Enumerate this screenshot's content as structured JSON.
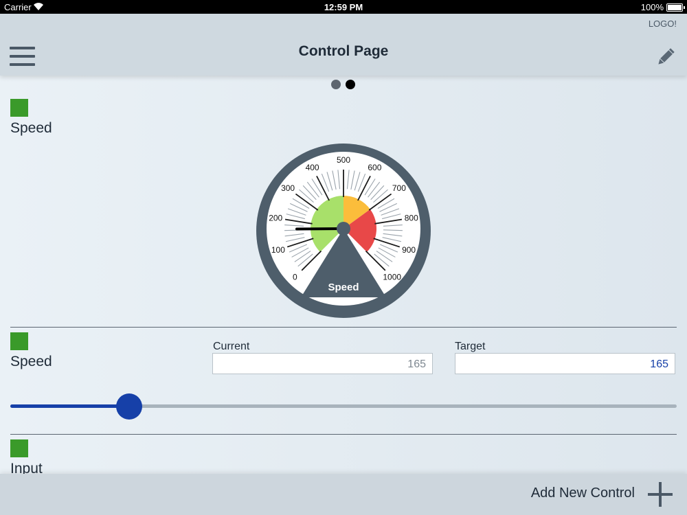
{
  "status_bar": {
    "carrier": "Carrier",
    "time": "12:59 PM",
    "battery": "100%"
  },
  "nav": {
    "title": "Control Page",
    "logo": "LOGO!",
    "menu_icon": "hamburger-menu-icon",
    "edit_icon": "pencil-icon"
  },
  "pager": {
    "pages": 2,
    "active_index": 1
  },
  "controls": [
    {
      "label": "Speed",
      "swatch_color": "#3a9a2a"
    },
    {
      "label": "Speed",
      "swatch_color": "#3a9a2a"
    },
    {
      "label": "Input",
      "swatch_color": "#3a9a2a"
    }
  ],
  "gauge": {
    "label": "Speed",
    "min": 0,
    "max": 1000,
    "tick_labels": [
      "0",
      "100",
      "200",
      "300",
      "400",
      "500",
      "600",
      "700",
      "800",
      "900",
      "1000"
    ],
    "value": 165,
    "zones": [
      {
        "from": 0,
        "to": 500,
        "color": "#a8e06a"
      },
      {
        "from": 500,
        "to": 700,
        "color": "#fbbd3b"
      },
      {
        "from": 700,
        "to": 1000,
        "color": "#e84848"
      }
    ],
    "colors": {
      "body": "#4e5e6b",
      "face": "#ffffff",
      "needle": "#000000"
    }
  },
  "fields": {
    "current": {
      "label": "Current",
      "value": "165"
    },
    "target": {
      "label": "Target",
      "value": "165"
    }
  },
  "slider": {
    "min": 0,
    "max": 1000,
    "value": 165,
    "fill_color": "#1640a8",
    "track_color": "#a8b3bc"
  },
  "bottom_bar": {
    "add_label": "Add New Control",
    "add_icon": "plus-icon"
  },
  "colors": {
    "accent": "#1640a8",
    "nav_bg": "#cfd9e0",
    "text": "#1f2b38"
  }
}
